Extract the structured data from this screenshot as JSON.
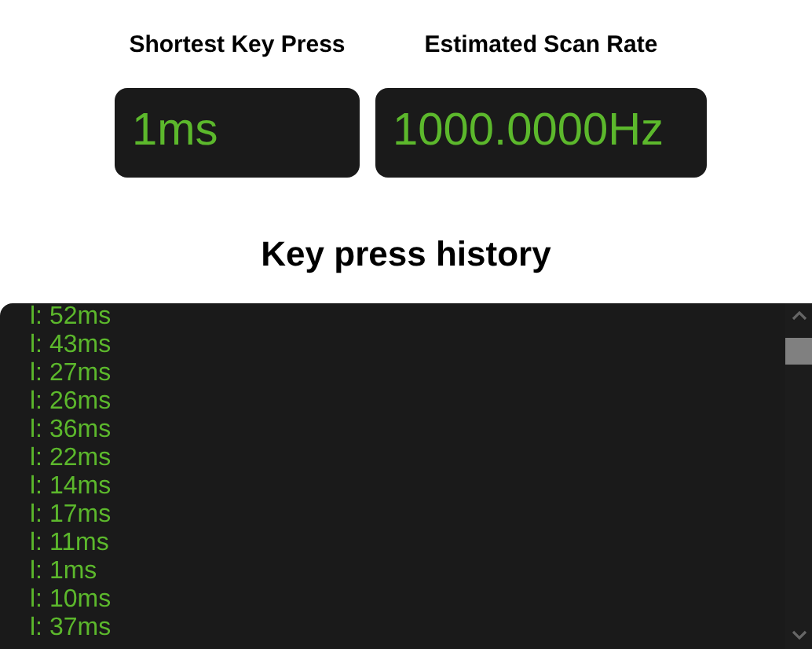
{
  "stats": [
    {
      "label": "Shortest Key Press",
      "value": "1ms"
    },
    {
      "label": "Estimated Scan Rate",
      "value": "1000.0000Hz"
    }
  ],
  "history": {
    "title": "Key press history",
    "entries": [
      "l: 52ms",
      "l: 43ms",
      "l: 27ms",
      "l: 26ms",
      "l: 36ms",
      "l: 22ms",
      "l: 14ms",
      "l: 17ms",
      "l: 11ms",
      "l: 1ms",
      "l: 10ms",
      "l: 37ms"
    ]
  }
}
